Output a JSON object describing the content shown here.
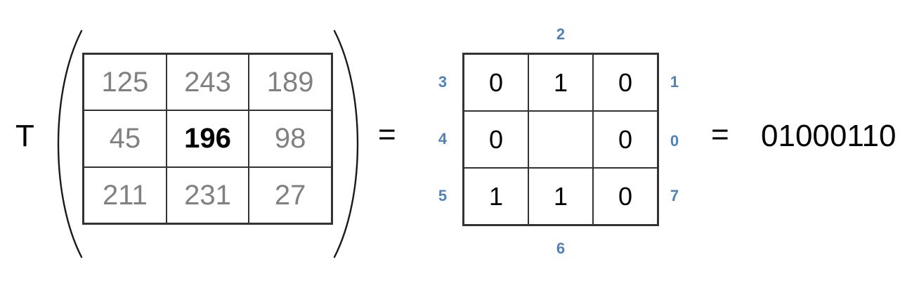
{
  "operator_label": "T",
  "equals_sign": "=",
  "result_code": "01000110",
  "input_grid": [
    [
      "125",
      "243",
      "189"
    ],
    [
      "45",
      "196",
      "98"
    ],
    [
      "211",
      "231",
      "27"
    ]
  ],
  "output_grid": [
    [
      "0",
      "1",
      "0"
    ],
    [
      "0",
      "",
      "0"
    ],
    [
      "1",
      "1",
      "0"
    ]
  ],
  "neighbor_indices": {
    "top": "2",
    "bottom": "6",
    "left_top": "3",
    "left_middle": "4",
    "left_bottom": "5",
    "right_top": "1",
    "right_middle": "0",
    "right_bottom": "7"
  },
  "colors": {
    "index_label": "#4f81bd",
    "input_value": "#808080",
    "center_value": "#000000",
    "grid_line": "#333333"
  }
}
